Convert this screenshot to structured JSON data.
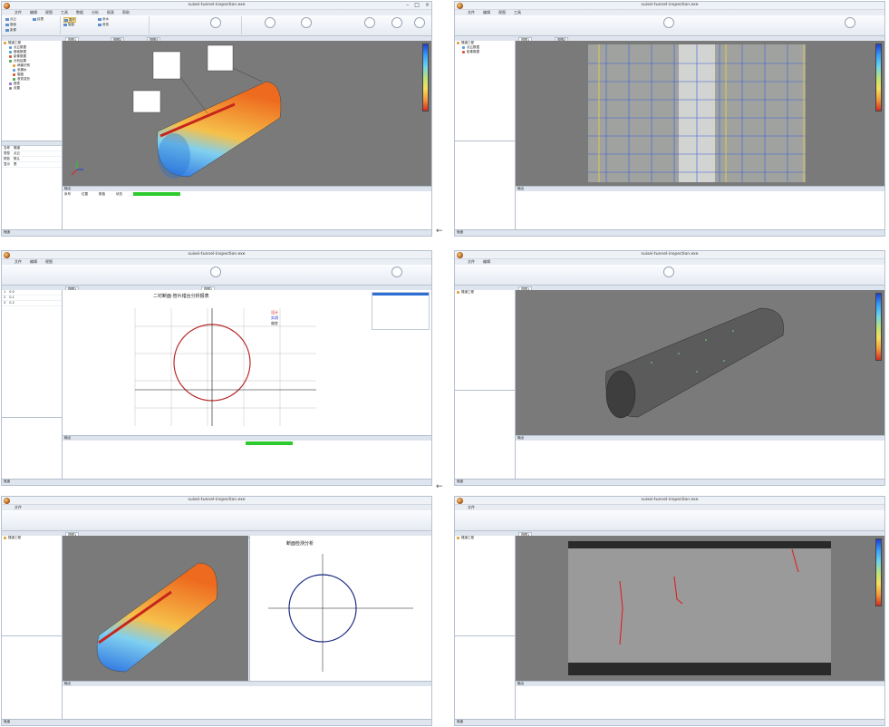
{
  "app": {
    "title": "suisei-tunnel-inspection.exe",
    "window_controls": [
      "–",
      "□",
      "×"
    ]
  },
  "menu": [
    "文件",
    "编辑",
    "视图",
    "工具",
    "数据",
    "分析",
    "报表",
    "帮助"
  ],
  "ribbon": {
    "buttons": [
      "点云",
      "断面",
      "影像",
      "纹理",
      "展开",
      "裂缝",
      "渗水",
      "收敛"
    ],
    "groups": [
      "数据",
      "处理",
      "分析",
      "输出"
    ]
  },
  "tree": {
    "items": [
      "隧道工程",
      "点云数据",
      "断面数据",
      "影像数据",
      "分析结果",
      "病害识别",
      "渗漏水",
      "裂缝",
      "收敛变形",
      "报表",
      "设置"
    ]
  },
  "props": {
    "rows": [
      {
        "k": "名称",
        "v": "隧道"
      },
      {
        "k": "类型",
        "v": "点云"
      },
      {
        "k": "颜色",
        "v": "默认"
      },
      {
        "k": "显示",
        "v": "是"
      }
    ]
  },
  "colorbar_labels": [
    "最大",
    "",
    "",
    "",
    "",
    "",
    "最小"
  ],
  "panels": [
    {
      "id": "p1",
      "tabs": [
        "视图1",
        "视图2",
        "视图3"
      ],
      "view_type": "tunnel-heatmap-annotated"
    },
    {
      "id": "p2",
      "tabs": [
        "视图1",
        "视图2",
        "视图3"
      ],
      "view_type": "unrolled-image-grid"
    },
    {
      "id": "p3",
      "tabs": [
        "视图1",
        "视图2",
        "视图3"
      ],
      "view_type": "section-plot",
      "plot_title": "二衬断面·管片错台分析报表",
      "legend": [
        "设计",
        "实测",
        "偏差"
      ]
    },
    {
      "id": "p4",
      "tabs": [
        "视图1",
        "视图2",
        "视图3"
      ],
      "view_type": "tunnel-pointcloud"
    },
    {
      "id": "p5",
      "tabs": [
        "视图1",
        "视图2",
        "视图3"
      ],
      "view_type": "split-heatmap-section",
      "plot_title": "断面检测分析"
    },
    {
      "id": "p6",
      "tabs": [
        "视图1",
        "视图2",
        "视图3"
      ],
      "view_type": "unrolled-crack-image"
    }
  ],
  "bottom": {
    "header": "输出",
    "rows": [
      [
        "序号",
        "位置",
        "数值",
        "状态"
      ]
    ]
  },
  "status": {
    "text": "就绪"
  }
}
